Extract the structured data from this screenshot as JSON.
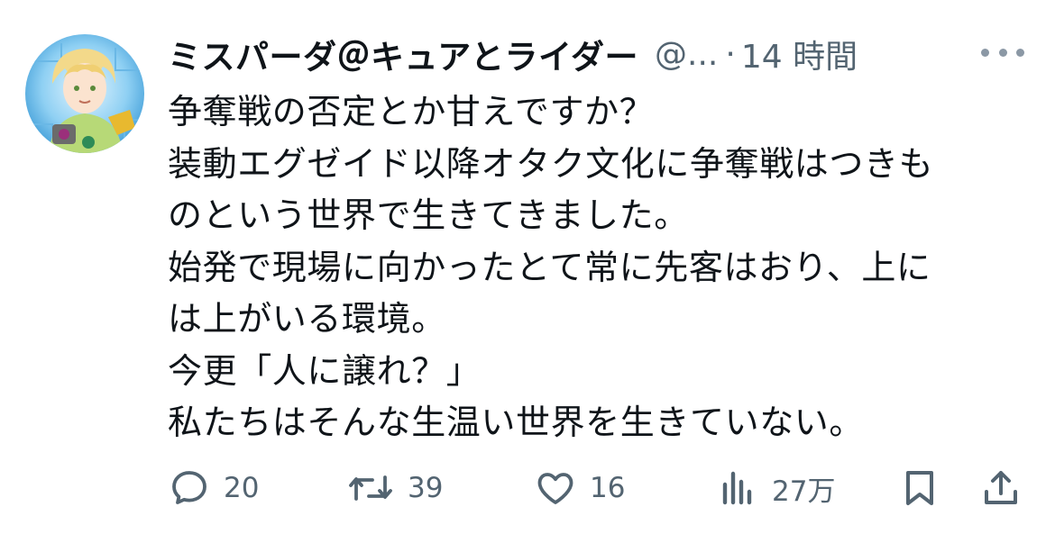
{
  "tweet": {
    "author_name": "ミスパーダ＠キュアとライダー",
    "handle": "@...",
    "separator": "·",
    "time": "14 時間",
    "lines": [
      "争奪戦の否定とか甘えですか？",
      "装動エグゼイド以降オタク文化に争奪戦はつきも",
      "のという世界で生きてきました。",
      "始発で現場に向かったとて常に先客はおり、上に",
      "は上がいる環境。",
      "今更「人に譲れ？」",
      "私たちはそんな生温い世界を生きていない。"
    ]
  },
  "actions": {
    "replies": "20",
    "retweets": "39",
    "likes": "16",
    "views": "27万"
  },
  "icons": {
    "reply": "reply-icon",
    "retweet": "retweet-icon",
    "like": "heart-icon",
    "views": "views-icon",
    "bookmark": "bookmark-icon",
    "share": "share-icon",
    "more": "more-icon"
  },
  "colors": {
    "text": "#0f1419",
    "secondary": "#536471",
    "icon": "#536471"
  }
}
